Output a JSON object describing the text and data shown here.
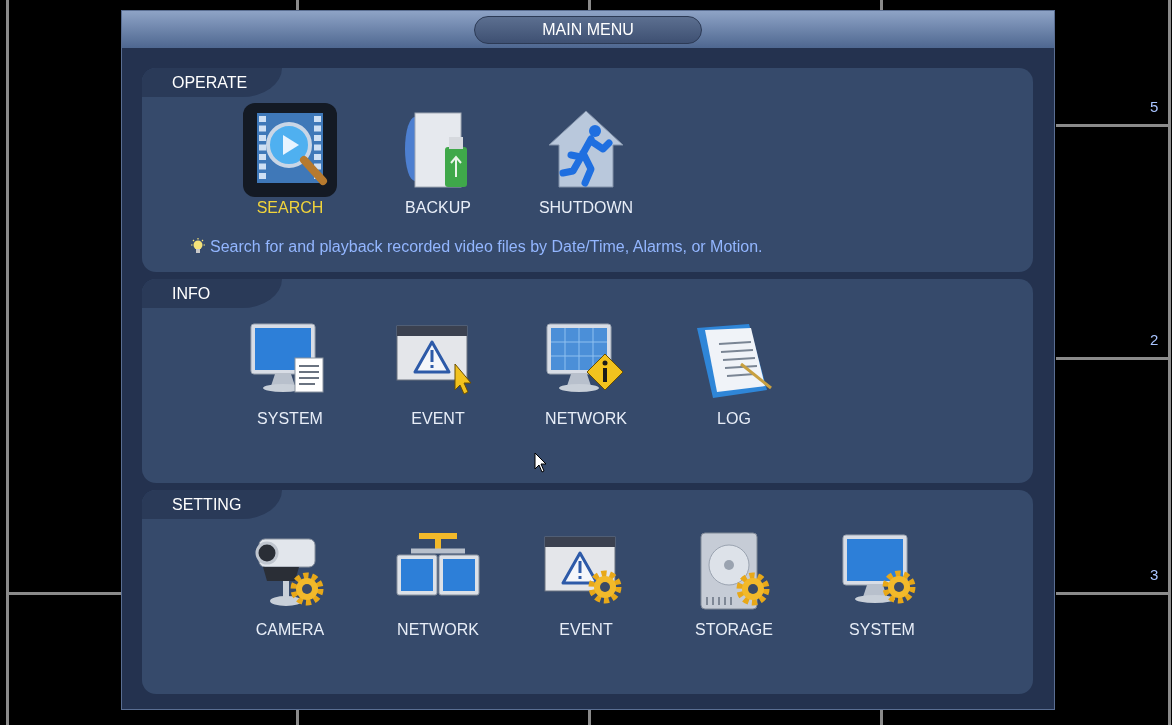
{
  "tiles": [
    {
      "number": "5"
    },
    {
      "number": "2"
    },
    {
      "number": "3"
    }
  ],
  "window": {
    "title": "MAIN MENU"
  },
  "sections": [
    {
      "label": "OPERATE",
      "items": [
        {
          "label": "SEARCH",
          "kind": "search",
          "selected": true
        },
        {
          "label": "BACKUP",
          "kind": "backup",
          "selected": false
        },
        {
          "label": "SHUTDOWN",
          "kind": "shutdown",
          "selected": false
        }
      ],
      "hint": "Search for and playback recorded video files by Date/Time, Alarms, or Motion."
    },
    {
      "label": "INFO",
      "items": [
        {
          "label": "SYSTEM",
          "kind": "system-info",
          "selected": false
        },
        {
          "label": "EVENT",
          "kind": "event-info",
          "selected": false
        },
        {
          "label": "NETWORK",
          "kind": "network-info",
          "selected": false
        },
        {
          "label": "LOG",
          "kind": "log",
          "selected": false
        }
      ]
    },
    {
      "label": "SETTING",
      "items": [
        {
          "label": "CAMERA",
          "kind": "camera-setting",
          "selected": false
        },
        {
          "label": "NETWORK",
          "kind": "network-setting",
          "selected": false
        },
        {
          "label": "EVENT",
          "kind": "event-setting",
          "selected": false
        },
        {
          "label": "STORAGE",
          "kind": "storage-setting",
          "selected": false
        },
        {
          "label": "SYSTEM",
          "kind": "system-setting",
          "selected": false
        }
      ]
    }
  ]
}
